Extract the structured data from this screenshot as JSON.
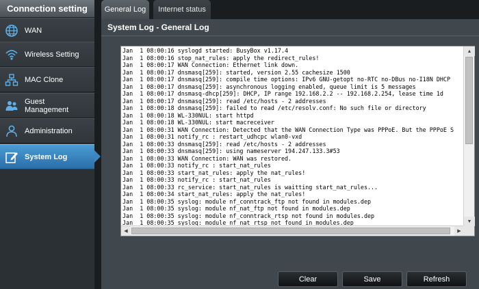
{
  "sidebar": {
    "header": "Connection setting",
    "items": [
      {
        "label": "WAN",
        "icon": "globe-icon"
      },
      {
        "label": "Wireless Setting",
        "icon": "wifi-icon"
      },
      {
        "label": "MAC Clone",
        "icon": "network-icon"
      },
      {
        "label": "Guest Management",
        "icon": "users-icon"
      },
      {
        "label": "Administration",
        "icon": "person-icon"
      },
      {
        "label": "System Log",
        "icon": "edit-icon",
        "active": true
      }
    ]
  },
  "tabs": [
    {
      "label": "General Log",
      "active": true
    },
    {
      "label": "Internet status",
      "active": false
    }
  ],
  "panel": {
    "title": "System Log - General Log"
  },
  "log": {
    "lines": [
      "Jan  1 08:00:16 syslogd started: BusyBox v1.17.4",
      "Jan  1 08:00:16 stop_nat_rules: apply the redirect_rules!",
      "Jan  1 08:00:17 WAN Connection: Ethernet link down.",
      "Jan  1 08:00:17 dnsmasq[259]: started, version 2.55 cachesize 1500",
      "Jan  1 08:00:17 dnsmasq[259]: compile time options: IPv6 GNU-getopt no-RTC no-DBus no-I18N DHCP",
      "Jan  1 08:00:17 dnsmasq[259]: asynchronous logging enabled, queue limit is 5 messages",
      "Jan  1 08:00:17 dnsmasq-dhcp[259]: DHCP, IP range 192.168.2.2 -- 192.168.2.254, lease time 1d",
      "Jan  1 08:00:17 dnsmasq[259]: read /etc/hosts - 2 addresses",
      "Jan  1 08:00:18 dnsmasq[259]: failed to read /etc/resolv.conf: No such file or directory",
      "Jan  1 08:00:18 WL-330NUL: start httpd",
      "Jan  1 08:00:18 WL-330NUL: start macreceiver",
      "Jan  1 08:00:31 WAN Connection: Detected that the WAN Connection Type was PPPoE. But the PPPoE S",
      "Jan  1 08:00:31 notify_rc : restart_udhcpc wlan0-vxd",
      "Jan  1 08:00:33 dnsmasq[259]: read /etc/hosts - 2 addresses",
      "Jan  1 08:00:33 dnsmasq[259]: using nameserver 194.247.133.3#53",
      "Jan  1 08:00:33 WAN Connection: WAN was restored.",
      "Jan  1 08:00:33 notify_rc : start_nat_rules",
      "Jan  1 08:00:33 start_nat_rules: apply the nat_rules!",
      "Jan  1 08:00:33 notify_rc : start_nat_rules",
      "Jan  1 08:00:33 rc_service: start_nat_rules is waitting start_nat_rules...",
      "Jan  1 08:00:34 start_nat_rules: apply the nat_rules!",
      "Jan  1 08:00:35 syslog: module nf_conntrack_ftp not found in modules.dep",
      "Jan  1 08:00:35 syslog: module nf_nat_ftp not found in modules.dep",
      "Jan  1 08:00:35 syslog: module nf_conntrack_rtsp not found in modules.dep",
      "Jan  1 08:00:35 syslog: module nf_nat_rtsp not found in modules.dep"
    ]
  },
  "buttons": {
    "clear": "Clear",
    "save": "Save",
    "refresh": "Refresh"
  },
  "colors": {
    "accent": "#3b86c3",
    "sidebar_bg": "#2b3034",
    "panel_bg": "#41484d"
  }
}
